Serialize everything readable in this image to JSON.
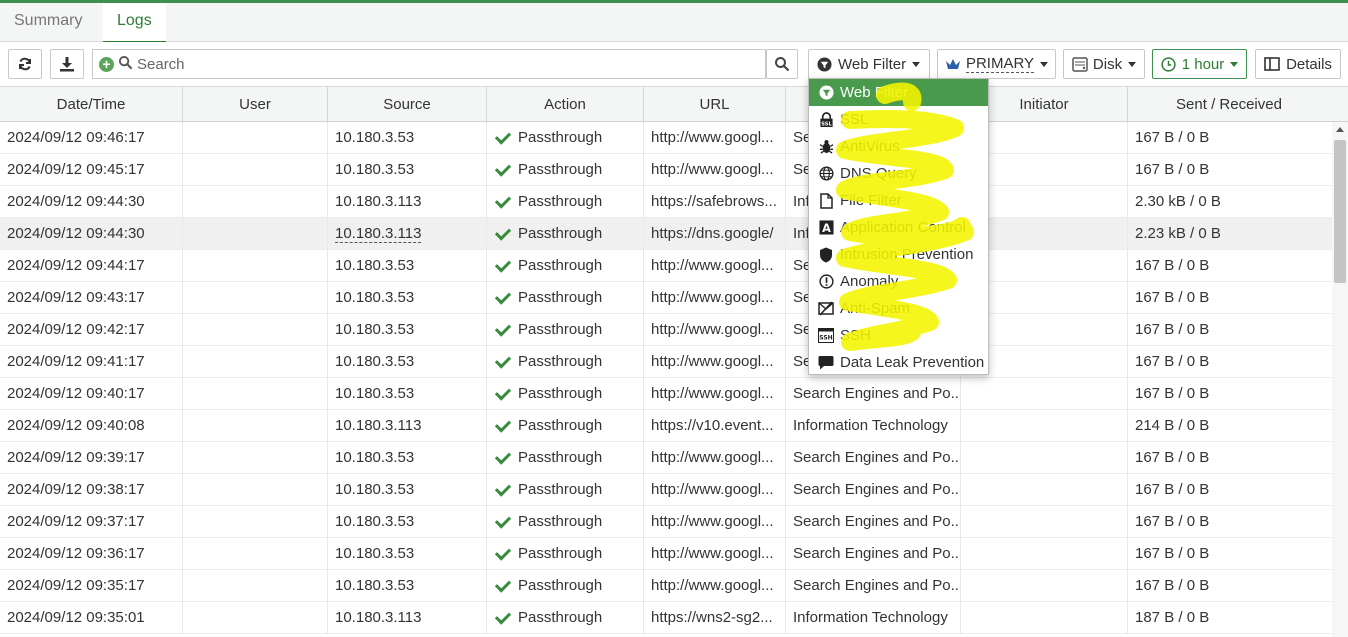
{
  "tabs": [
    {
      "label": "Summary",
      "active": false
    },
    {
      "label": "Logs",
      "active": true
    }
  ],
  "toolbar": {
    "refresh_icon": "refresh-icon",
    "download_icon": "download-icon",
    "search_placeholder": "Search",
    "log_type": "Web Filter",
    "device": "PRIMARY",
    "storage": "Disk",
    "time_range": "1 hour",
    "details_label": "Details"
  },
  "columns": [
    "Date/Time",
    "User",
    "Source",
    "Action",
    "URL",
    "",
    "Initiator",
    "Sent / Received"
  ],
  "rows": [
    {
      "datetime": "2024/09/12 09:46:17",
      "user": "",
      "source": "10.180.3.53",
      "action": "Passthrough",
      "url": "http://www.googl...",
      "category": "Se",
      "initiator": "",
      "sent_received": "167 B / 0 B"
    },
    {
      "datetime": "2024/09/12 09:45:17",
      "user": "",
      "source": "10.180.3.53",
      "action": "Passthrough",
      "url": "http://www.googl...",
      "category": "Se",
      "initiator": "",
      "sent_received": "167 B / 0 B"
    },
    {
      "datetime": "2024/09/12 09:44:30",
      "user": "",
      "source": "10.180.3.113",
      "action": "Passthrough",
      "url": "https://safebrows...",
      "category": "Inf",
      "initiator": "",
      "sent_received": "2.30 kB / 0 B"
    },
    {
      "datetime": "2024/09/12 09:44:30",
      "user": "",
      "source": "10.180.3.113",
      "action": "Passthrough",
      "url": "https://dns.google/",
      "category": "Inf",
      "initiator": "",
      "sent_received": "2.23 kB / 0 B"
    },
    {
      "datetime": "2024/09/12 09:44:17",
      "user": "",
      "source": "10.180.3.53",
      "action": "Passthrough",
      "url": "http://www.googl...",
      "category": "Se",
      "initiator": "",
      "sent_received": "167 B / 0 B"
    },
    {
      "datetime": "2024/09/12 09:43:17",
      "user": "",
      "source": "10.180.3.53",
      "action": "Passthrough",
      "url": "http://www.googl...",
      "category": "Se",
      "initiator": "",
      "sent_received": "167 B / 0 B"
    },
    {
      "datetime": "2024/09/12 09:42:17",
      "user": "",
      "source": "10.180.3.53",
      "action": "Passthrough",
      "url": "http://www.googl...",
      "category": "Se",
      "initiator": "",
      "sent_received": "167 B / 0 B"
    },
    {
      "datetime": "2024/09/12 09:41:17",
      "user": "",
      "source": "10.180.3.53",
      "action": "Passthrough",
      "url": "http://www.googl...",
      "category": "Se",
      "initiator": "",
      "sent_received": "167 B / 0 B"
    },
    {
      "datetime": "2024/09/12 09:40:17",
      "user": "",
      "source": "10.180.3.53",
      "action": "Passthrough",
      "url": "http://www.googl...",
      "category": "Search Engines and Po...",
      "initiator": "",
      "sent_received": "167 B / 0 B"
    },
    {
      "datetime": "2024/09/12 09:40:08",
      "user": "",
      "source": "10.180.3.113",
      "action": "Passthrough",
      "url": "https://v10.event...",
      "category": "Information Technology",
      "initiator": "",
      "sent_received": "214 B / 0 B"
    },
    {
      "datetime": "2024/09/12 09:39:17",
      "user": "",
      "source": "10.180.3.53",
      "action": "Passthrough",
      "url": "http://www.googl...",
      "category": "Search Engines and Po...",
      "initiator": "",
      "sent_received": "167 B / 0 B"
    },
    {
      "datetime": "2024/09/12 09:38:17",
      "user": "",
      "source": "10.180.3.53",
      "action": "Passthrough",
      "url": "http://www.googl...",
      "category": "Search Engines and Po...",
      "initiator": "",
      "sent_received": "167 B / 0 B"
    },
    {
      "datetime": "2024/09/12 09:37:17",
      "user": "",
      "source": "10.180.3.53",
      "action": "Passthrough",
      "url": "http://www.googl...",
      "category": "Search Engines and Po...",
      "initiator": "",
      "sent_received": "167 B / 0 B"
    },
    {
      "datetime": "2024/09/12 09:36:17",
      "user": "",
      "source": "10.180.3.53",
      "action": "Passthrough",
      "url": "http://www.googl...",
      "category": "Search Engines and Po...",
      "initiator": "",
      "sent_received": "167 B / 0 B"
    },
    {
      "datetime": "2024/09/12 09:35:17",
      "user": "",
      "source": "10.180.3.53",
      "action": "Passthrough",
      "url": "http://www.googl...",
      "category": "Search Engines and Po...",
      "initiator": "",
      "sent_received": "167 B / 0 B"
    },
    {
      "datetime": "2024/09/12 09:35:01",
      "user": "",
      "source": "10.180.3.113",
      "action": "Passthrough",
      "url": "https://wns2-sg2...",
      "category": "Information Technology",
      "initiator": "",
      "sent_received": "187 B / 0 B"
    }
  ],
  "dropdown": {
    "items": [
      {
        "label": "Web Filter",
        "icon": "web-filter-icon",
        "selected": true
      },
      {
        "label": "SSL",
        "icon": "ssl-icon",
        "selected": false
      },
      {
        "label": "AntiVirus",
        "icon": "bug-icon",
        "selected": false
      },
      {
        "label": "DNS Query",
        "icon": "globe-icon",
        "selected": false
      },
      {
        "label": "File Filter",
        "icon": "file-icon",
        "selected": false
      },
      {
        "label": "Application Control",
        "icon": "application-icon",
        "selected": false
      },
      {
        "label": "Intrusion Prevention",
        "icon": "shield-icon",
        "selected": false
      },
      {
        "label": "Anomaly",
        "icon": "alert-icon",
        "selected": false
      },
      {
        "label": "Anti-Spam",
        "icon": "anti-spam-icon",
        "selected": false
      },
      {
        "label": "SSH",
        "icon": "ssh-icon",
        "selected": false
      },
      {
        "label": "Data Leak Prevention",
        "icon": "chat-bubble-icon",
        "selected": false
      }
    ]
  },
  "colors": {
    "accent": "#2e7d32",
    "selected_item": "#4a9a4e",
    "check": "#3a8a3a",
    "highlighter": "#f5f500"
  }
}
